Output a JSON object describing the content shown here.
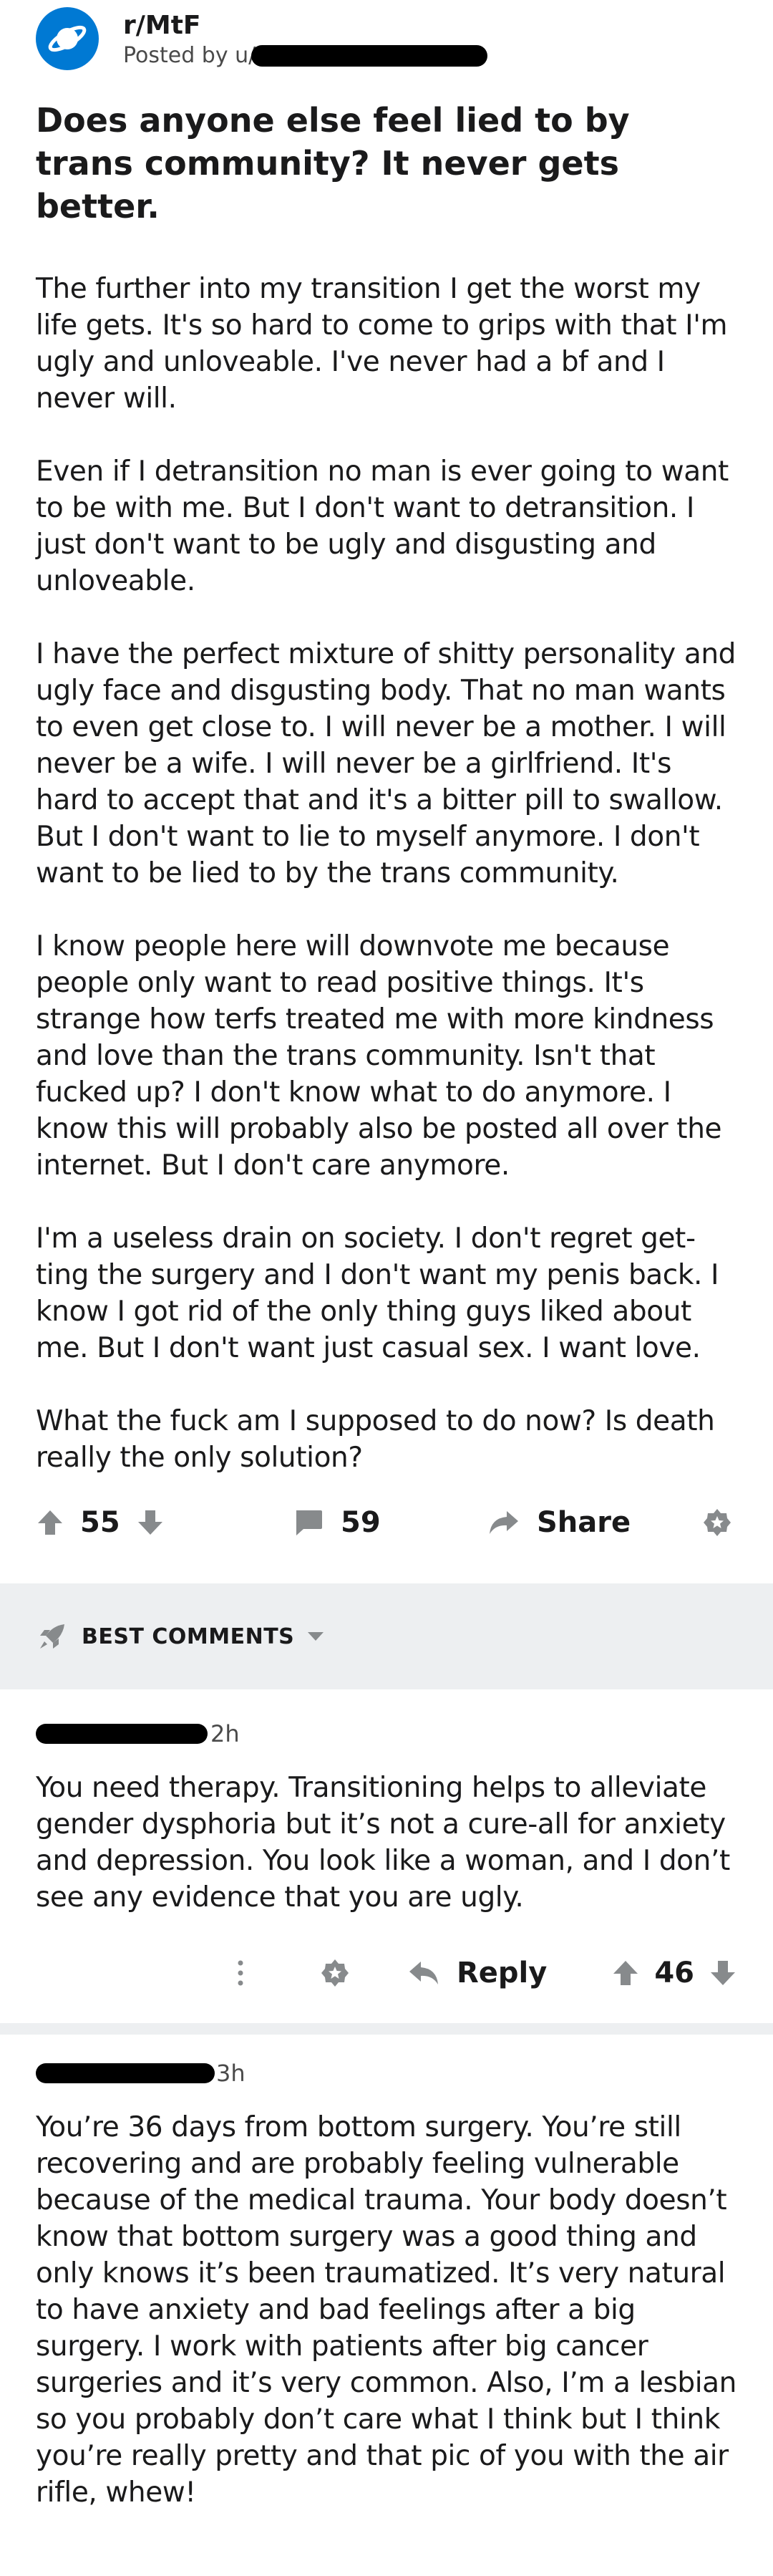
{
  "post": {
    "subreddit": "r/MtF",
    "posted_by_prefix": "Posted by u/",
    "title": "Does anyone else feel lied to by trans community? It never gets better.",
    "paragraphs": [
      "The further into my transition I get the worst my life gets. It's so hard to come to grips with that I'm ugly and unloveable. I've never had a bf and I never will.",
      "Even if I detransition no man is ever going to want to be with me. But I don't want to detransition. I just don't want to be ugly and disgusting and unloveable.",
      "I have the perfect mixture of shitty personality and ugly face and disgusting body. That no man wants to even get close to. I will never be a mother. I will never be a wife. I will never be a girlfriend. It's hard to accept that and it's a bitter pill to swallow. But I don't want to lie to myself anymore. I don't want to be lied to by the trans community.",
      "I know people here will downvote me because people only want to read positive things. It's strange how terfs treated me with more kindness and love than the trans community. Isn't that fucked up? I don't know what to do anymore. I know this will probably also be posted all over the internet. But I don't care anymore.",
      "I'm a useless drain on society. I don't regret get-ting the surgery and I don't want my penis back. I know I got rid of the only thing guys liked about me. But I don't want just casual sex. I want love.",
      "What the fuck am I supposed to do now? Is death really the only solution?"
    ],
    "score": "55",
    "comments_count": "59",
    "share_label": "Share"
  },
  "comments_header": {
    "sort_label": "BEST COMMENTS"
  },
  "comments": [
    {
      "age": "2h",
      "body": "You need therapy. Transitioning helps to alleviate gender dysphoria but it’s not a cure-all for anxiety and depression. You look like a woman, and I don’t see any evidence that you are ugly.",
      "reply_label": "Reply",
      "score": "46"
    },
    {
      "age": "3h",
      "body": "You’re 36 days from bottom surgery. You’re still recovering and are probably feeling vulnerable because of the medical trauma. Your body doesn’t know that bottom surgery was a good thing and only knows it’s been traumatized. It’s very natural to have anxiety and bad feelings after a big surgery. I work with patients after big cancer surgeries and it’s very common. Also, I’m a lesbian so you probably don’t care what I think but I think you’re really pretty and that pic of you with the air rifle, whew!"
    }
  ],
  "icons": {
    "subreddit_avatar": "reddit-planet-icon",
    "upvote": "arrow-up-icon",
    "downvote": "arrow-down-icon",
    "comment": "speech-bubble-icon",
    "share": "share-arrow-icon",
    "award": "award-icon",
    "sort": "rocket-icon",
    "sort_dropdown": "caret-down-icon",
    "more": "vertical-dots-icon",
    "reply": "reply-arrow-icon"
  },
  "colors": {
    "avatar_blue": "#0079d3",
    "text": "#1a1a1b",
    "icon_gray": "#878a8c",
    "band_gray": "#edeff1"
  }
}
